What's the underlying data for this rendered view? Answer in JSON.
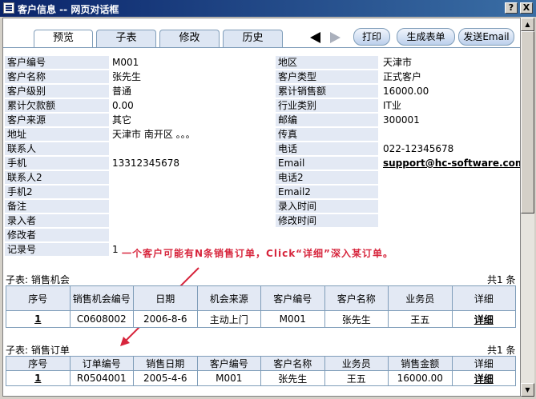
{
  "window": {
    "title": "客户信息 -- 网页对话框",
    "help_btn": "?",
    "close_btn": "X"
  },
  "tabs": [
    "预览",
    "子表",
    "修改",
    "历史"
  ],
  "buttons": {
    "print": "打印",
    "generate_form": "生成表单",
    "send_email": "发送Email"
  },
  "left_fields": [
    {
      "label": "客户编号",
      "value": "M001"
    },
    {
      "label": "客户名称",
      "value": "张先生"
    },
    {
      "label": "客户级别",
      "value": "普通"
    },
    {
      "label": "累计欠款额",
      "value": "0.00"
    },
    {
      "label": "客户来源",
      "value": "其它"
    },
    {
      "label": "地址",
      "value": "天津市 南开区 。。。"
    },
    {
      "label": "联系人",
      "value": ""
    },
    {
      "label": "手机",
      "value": "13312345678"
    },
    {
      "label": "联系人2",
      "value": ""
    },
    {
      "label": "手机2",
      "value": ""
    },
    {
      "label": "备注",
      "value": ""
    },
    {
      "label": "录入者",
      "value": ""
    },
    {
      "label": "修改者",
      "value": ""
    },
    {
      "label": "记录号",
      "value": "1"
    }
  ],
  "right_fields": [
    {
      "label": "地区",
      "value": "天津市"
    },
    {
      "label": "客户类型",
      "value": "正式客户"
    },
    {
      "label": "累计销售额",
      "value": "16000.00"
    },
    {
      "label": "行业类别",
      "value": "IT业"
    },
    {
      "label": "邮编",
      "value": "300001"
    },
    {
      "label": "传真",
      "value": ""
    },
    {
      "label": "电话",
      "value": "022-12345678"
    },
    {
      "label": "Email",
      "value": "support@hc-software.com"
    },
    {
      "label": "电话2",
      "value": ""
    },
    {
      "label": "Email2",
      "value": ""
    },
    {
      "label": "录入时间",
      "value": ""
    },
    {
      "label": "修改时间",
      "value": ""
    }
  ],
  "annotation": "一个客户可能有N条销售订单，Click“详细”深入某订单。",
  "opportunities": {
    "title": "子表: 销售机会",
    "count": "共1 条",
    "headers": [
      "序号",
      "销售机会编号",
      "日期",
      "机会来源",
      "客户编号",
      "客户名称",
      "业务员",
      "详细"
    ],
    "rows": [
      [
        "1",
        "C0608002",
        "2006-8-6",
        "主动上门",
        "M001",
        "张先生",
        "王五",
        "详细"
      ]
    ]
  },
  "orders": {
    "title": "子表: 销售订单",
    "count": "共1 条",
    "headers": [
      "序号",
      "订单编号",
      "销售日期",
      "客户编号",
      "客户名称",
      "业务员",
      "销售金额",
      "详细"
    ],
    "rows": [
      [
        "1",
        "R0504001",
        "2005-4-6",
        "M001",
        "张先生",
        "王五",
        "16000.00",
        "详细"
      ]
    ]
  }
}
